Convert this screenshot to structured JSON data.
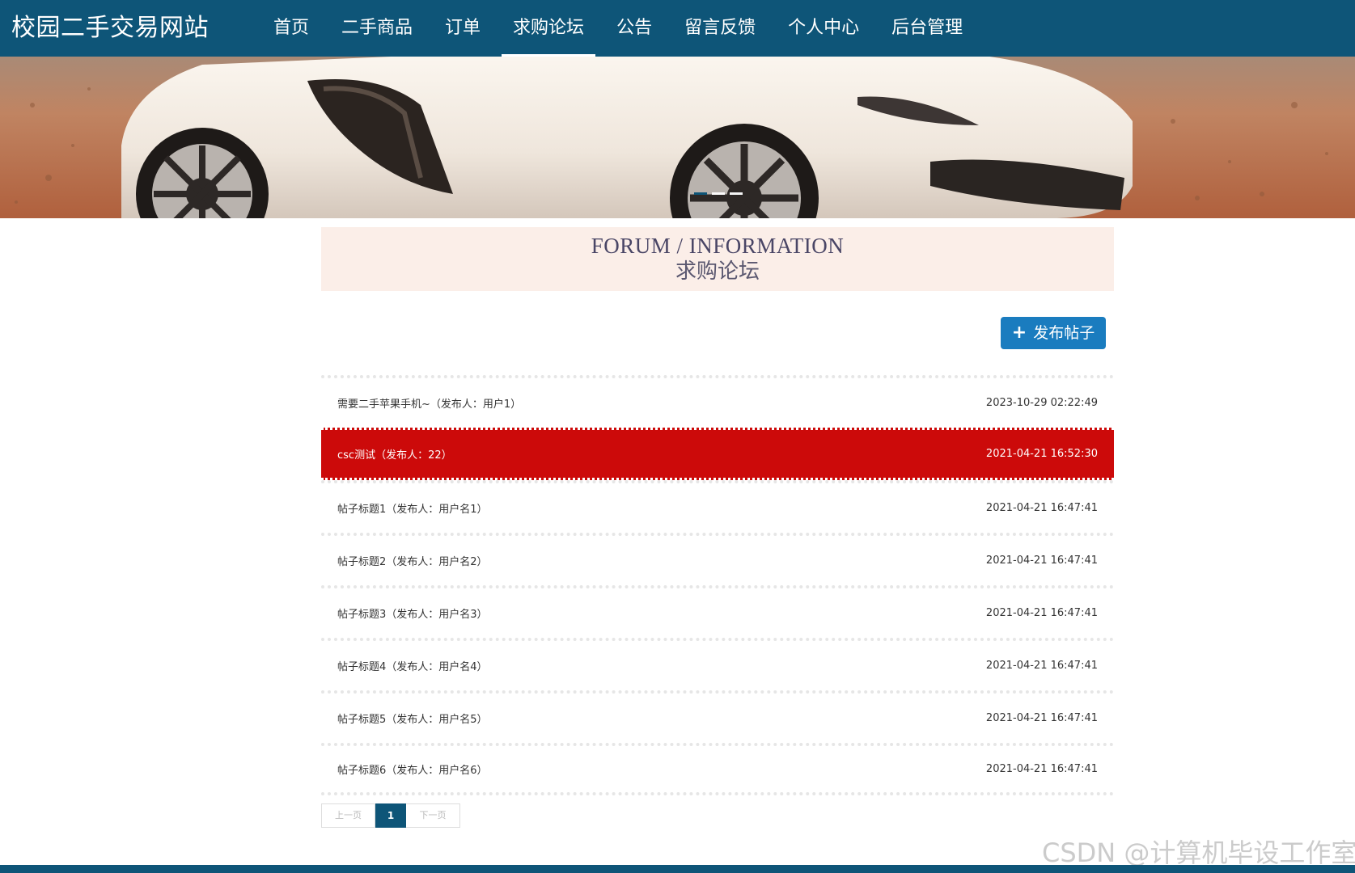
{
  "brand": {
    "title": "校园二手交易网站"
  },
  "nav": {
    "items": [
      {
        "label": "首页"
      },
      {
        "label": "二手商品"
      },
      {
        "label": "订单"
      },
      {
        "label": "求购论坛"
      },
      {
        "label": "公告"
      },
      {
        "label": "留言反馈"
      },
      {
        "label": "个人中心"
      },
      {
        "label": "后台管理"
      }
    ],
    "active_index": 3
  },
  "banner": {
    "carousel_total": 3,
    "carousel_active_index": 0,
    "image_description_icon": "car-photo"
  },
  "section": {
    "title_en": "FORUM / INFORMATION",
    "title_cn": "求购论坛"
  },
  "toolbar": {
    "publish_label": "发布帖子",
    "publish_icon": "plus-icon"
  },
  "posts": [
    {
      "title": "需要二手苹果手机~（发布人：用户1）",
      "time": "2023-10-29 02:22:49",
      "highlighted": false
    },
    {
      "title": "csc测试（发布人：22）",
      "time": "2021-04-21 16:52:30",
      "highlighted": true
    },
    {
      "title": "帖子标题1（发布人：用户名1）",
      "time": "2021-04-21 16:47:41",
      "highlighted": false
    },
    {
      "title": "帖子标题2（发布人：用户名2）",
      "time": "2021-04-21 16:47:41",
      "highlighted": false
    },
    {
      "title": "帖子标题3（发布人：用户名3）",
      "time": "2021-04-21 16:47:41",
      "highlighted": false
    },
    {
      "title": "帖子标题4（发布人：用户名4）",
      "time": "2021-04-21 16:47:41",
      "highlighted": false
    },
    {
      "title": "帖子标题5（发布人：用户名5）",
      "time": "2021-04-21 16:47:41",
      "highlighted": false
    },
    {
      "title": "帖子标题6（发布人：用户名6）",
      "time": "2021-04-21 16:47:41",
      "highlighted": false
    }
  ],
  "pagination": {
    "prev_label": "上一页",
    "current_page": "1",
    "next_label": "下一页"
  },
  "watermark": {
    "text": "CSDN @计算机毕设工作室"
  },
  "colors": {
    "nav_bg": "#0e5578",
    "highlight_row": "#cc0a0a",
    "publish_button": "#1a7cbf",
    "section_title_bg": "#fbeee8"
  }
}
